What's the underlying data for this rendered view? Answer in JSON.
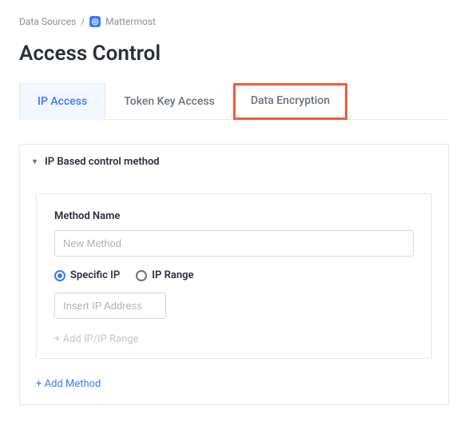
{
  "breadcrumb": {
    "root": "Data Sources",
    "sep": "/",
    "current": "Mattermost",
    "icon_glyph": "◎"
  },
  "page_title": "Access Control",
  "tabs": {
    "ip": "IP Access",
    "token": "Token Key Access",
    "encryption": "Data Encryption"
  },
  "panel": {
    "title": "IP Based control method"
  },
  "form": {
    "method_name_label": "Method Name",
    "method_name_placeholder": "New Method",
    "radio_specific": "Specific IP",
    "radio_range": "IP Range",
    "ip_placeholder": "Insert IP Address",
    "add_ip_range": "+ Add IP/IP Range"
  },
  "actions": {
    "add_method": "+ Add Method"
  }
}
